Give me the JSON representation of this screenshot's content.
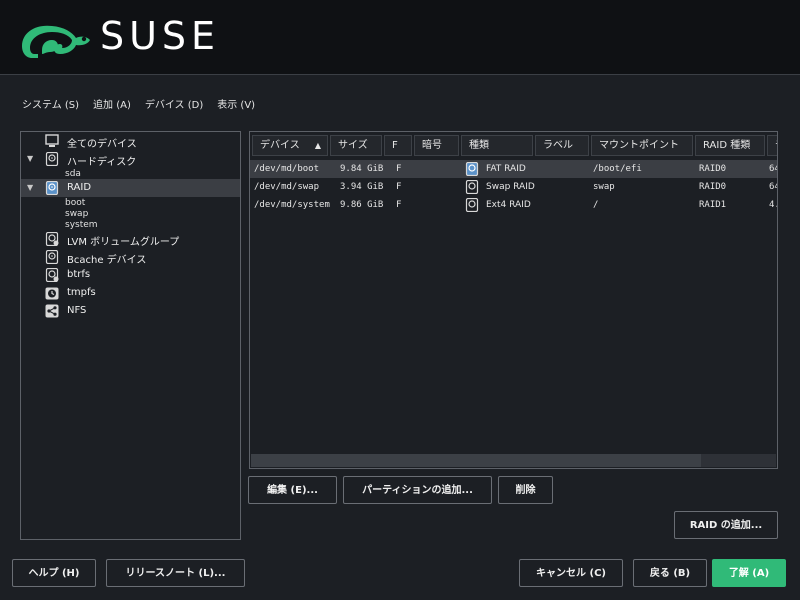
{
  "branding": {
    "name": "SUSE",
    "colors": {
      "chameleon": "#30ba78",
      "banner": "#0f1114"
    }
  },
  "menu": {
    "system": "システム (S)",
    "add": "追加 (A)",
    "device": "デバイス (D)",
    "view": "表示 (V)"
  },
  "tree": {
    "all_devices": {
      "label": "全てのデバイス",
      "icon": "monitor-icon"
    },
    "hard_disks": {
      "label": "ハードディスク",
      "icon": "disk-icon",
      "children": [
        "sda"
      ]
    },
    "raid": {
      "label": "RAID",
      "icon": "raid-icon",
      "selected": true,
      "children": [
        "boot",
        "swap",
        "system"
      ]
    },
    "lvm": {
      "label": "LVM ボリュームグループ",
      "icon": "lvm-icon"
    },
    "bcache": {
      "label": "Bcache デバイス",
      "icon": "bcache-icon"
    },
    "btrfs": {
      "label": "btrfs",
      "icon": "btrfs-icon"
    },
    "tmpfs": {
      "label": "tmpfs",
      "icon": "clock-icon"
    },
    "nfs": {
      "label": "NFS",
      "icon": "share-icon"
    }
  },
  "table": {
    "columns": [
      "デバイス",
      "サイズ",
      "F",
      "暗号",
      "種類",
      "ラベル",
      "マウントポイント",
      "RAID 種類",
      "チ"
    ],
    "sort_column": "デバイス",
    "rows": [
      {
        "device": "/dev/md/boot",
        "size": "9.84 GiB",
        "f": "F",
        "enc": "",
        "type": "FAT RAID",
        "label": "",
        "mount": "/boot/efi",
        "raid": "RAID0",
        "chunk": "64",
        "selected": true
      },
      {
        "device": "/dev/md/swap",
        "size": "3.94 GiB",
        "f": "F",
        "enc": "",
        "type": "Swap RAID",
        "label": "",
        "mount": "swap",
        "raid": "RAID0",
        "chunk": "64"
      },
      {
        "device": "/dev/md/system",
        "size": "9.86 GiB",
        "f": "F",
        "enc": "",
        "type": "Ext4 RAID",
        "label": "",
        "mount": "/",
        "raid": "RAID1",
        "chunk": "4."
      }
    ]
  },
  "actions": {
    "edit": "編集 (E)...",
    "add_partition": "パーティションの追加...",
    "delete": "削除",
    "add_raid": "RAID の追加..."
  },
  "footer": {
    "help": "ヘルプ (H)",
    "release_notes": "リリースノート (L)...",
    "cancel": "キャンセル (C)",
    "back": "戻る (B)",
    "ok": "了解 (A)"
  }
}
